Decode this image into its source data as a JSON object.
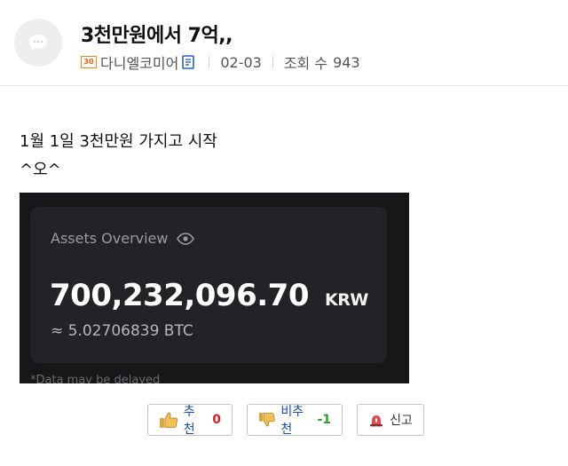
{
  "post": {
    "title": "3천만원에서 7억,,",
    "author_level": "30",
    "author": "다니엘코미어",
    "date": "02-03",
    "views_label": "조회 수",
    "views": "943"
  },
  "content": {
    "line1": "1월 1일 3천만원 가지고 시작",
    "line2": "^오^"
  },
  "screenshot": {
    "card_title": "Assets Overview",
    "amount": "700,232,096.70",
    "currency": "KRW",
    "btc": "≈ 5.02706839 BTC",
    "note": "*Data may be delayed"
  },
  "buttons": {
    "upvote_label": "추천",
    "upvote_count": "0",
    "downvote_label": "비추천",
    "downvote_count": "-1",
    "report_label": "신고"
  },
  "icons": {
    "avatar": "speech-bubble-icon",
    "doc": "document-icon",
    "eye": "eye-icon",
    "thumbs_up": "thumbs-up-icon",
    "thumbs_down": "thumbs-down-icon",
    "siren": "siren-icon"
  }
}
